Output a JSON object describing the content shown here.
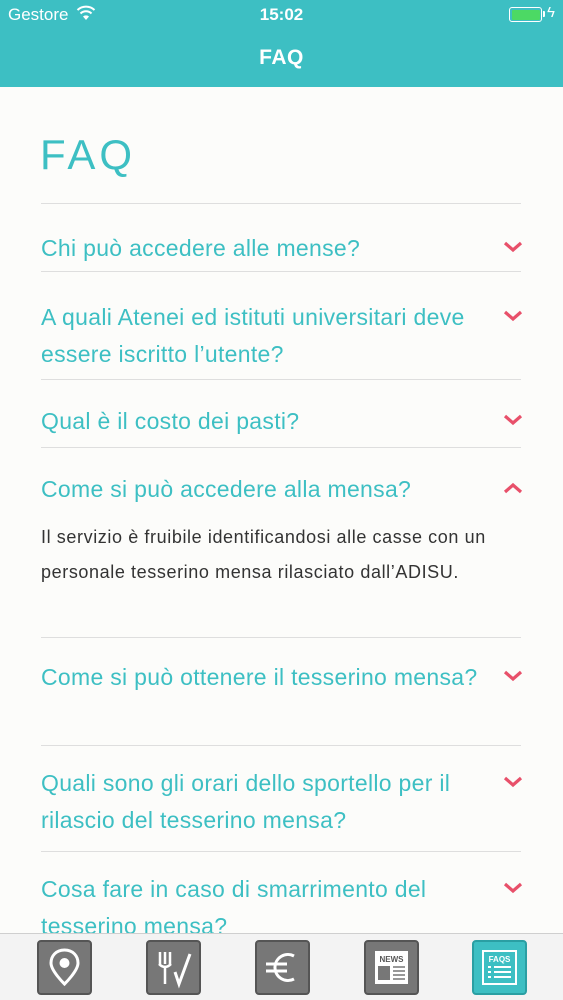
{
  "status_bar": {
    "carrier": "Gestore",
    "time": "15:02",
    "battery_color": "#4cd964"
  },
  "header": {
    "title": "FAQ",
    "background": "#3dbfc3"
  },
  "page": {
    "title": "FAQ"
  },
  "faqs": [
    {
      "question": "Chi può accedere alle mense?",
      "expanded": false
    },
    {
      "question": "A quali Atenei ed istituti universitari deve essere iscritto l’utente?",
      "expanded": false
    },
    {
      "question": "Qual è il costo dei pasti?",
      "expanded": false
    },
    {
      "question": "Come si può accedere alla mensa?",
      "expanded": true,
      "answer": "Il servizio è fruibile identificandosi alle casse con un personale tesserino mensa rilasciato dall’ADISU."
    },
    {
      "question": "Come si può ottenere il tesserino mensa?",
      "expanded": false
    },
    {
      "question": "Quali sono gli orari dello sportello per il rilascio del tesserino mensa?",
      "expanded": false
    },
    {
      "question": "Cosa fare in caso di smarrimento del tesserino mensa?",
      "expanded": false
    }
  ],
  "tabbar": {
    "tabs": [
      {
        "icon": "map-pin-icon",
        "active": false
      },
      {
        "icon": "fork-knife-icon",
        "active": false
      },
      {
        "icon": "euro-icon",
        "active": false
      },
      {
        "icon": "news-icon",
        "label": "NEWS",
        "active": false
      },
      {
        "icon": "faqs-icon",
        "label": "FAQS",
        "active": true
      }
    ]
  },
  "colors": {
    "accent": "#3dbfc3",
    "chevron": "#e8506a",
    "answer_text": "#333333"
  }
}
